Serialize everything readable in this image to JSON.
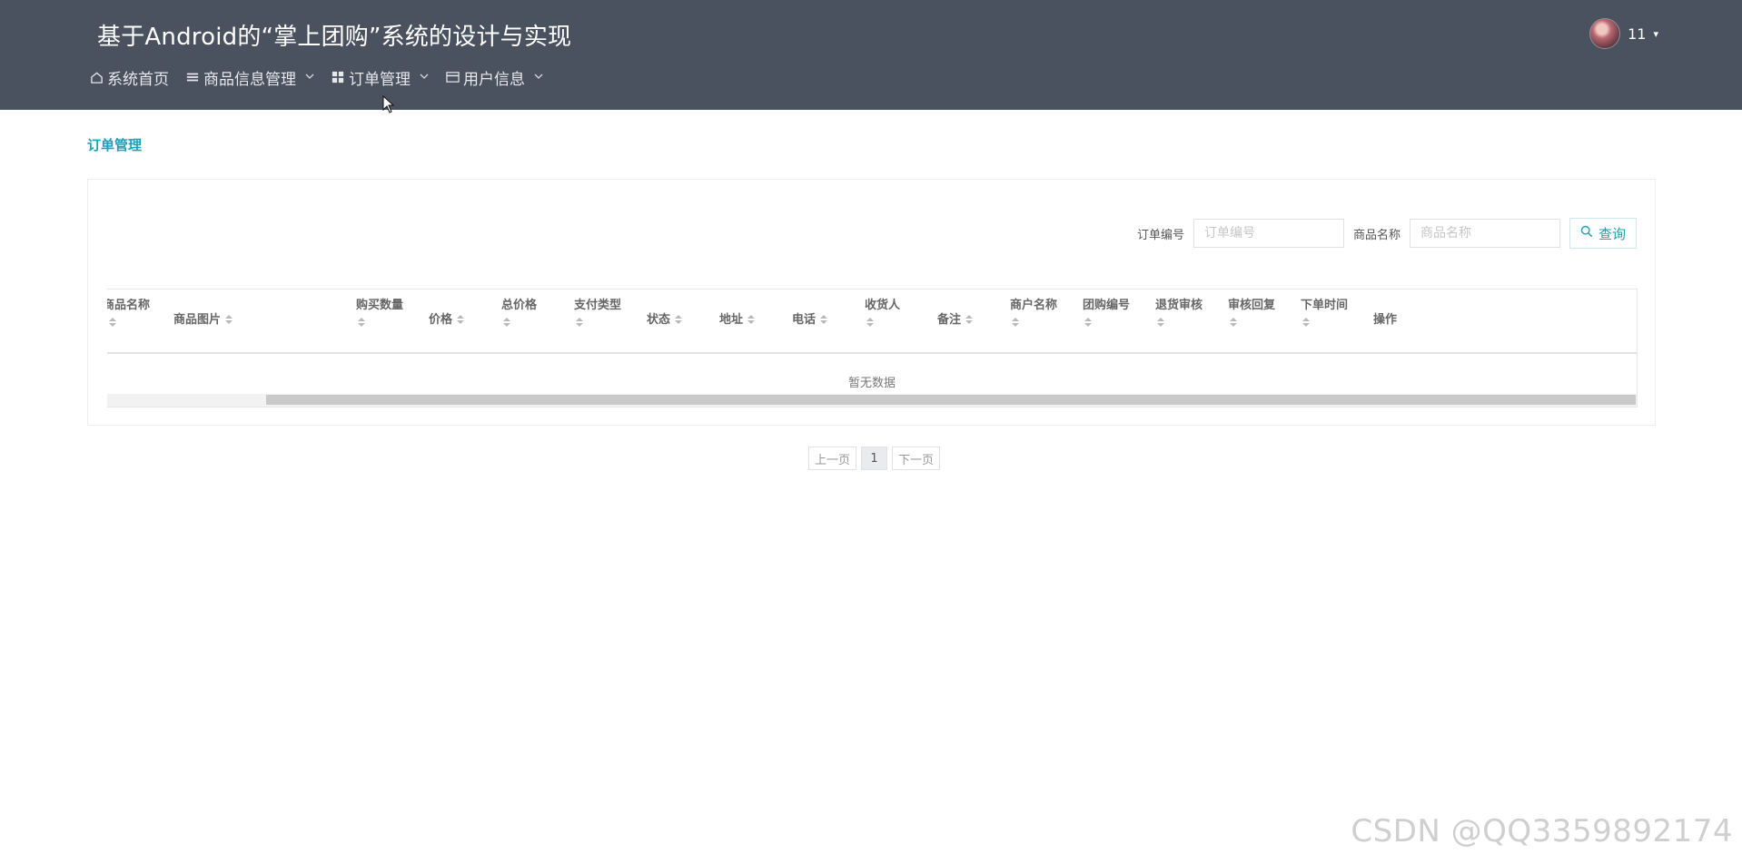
{
  "app": {
    "title": "基于Android的“掌上团购”系统的设计与实现"
  },
  "user": {
    "name": "11",
    "caret": "▾"
  },
  "nav": [
    {
      "label": "系统首页",
      "icon": "home-icon",
      "dropdown": false
    },
    {
      "label": "商品信息管理",
      "icon": "list-icon",
      "dropdown": true
    },
    {
      "label": "订单管理",
      "icon": "grid-icon",
      "dropdown": true
    },
    {
      "label": "用户信息",
      "icon": "card-icon",
      "dropdown": true
    }
  ],
  "breadcrumb": "订单管理",
  "search": {
    "order_no_label": "订单编号",
    "order_no_placeholder": "订单编号",
    "product_name_label": "商品名称",
    "product_name_placeholder": "商品名称",
    "button_label": "查询"
  },
  "table": {
    "columns": [
      "商品名称",
      "商品图片",
      "购买数量",
      "价格",
      "总价格",
      "支付类型",
      "状态",
      "地址",
      "电话",
      "收货人",
      "备注",
      "商户名称",
      "团购编号",
      "退货审核",
      "审核回复",
      "下单时间",
      "操作"
    ],
    "empty_text": "暂无数据"
  },
  "pagination": {
    "prev": "上一页",
    "current": "1",
    "next": "下一页"
  },
  "watermark": "CSDN @QQ3359892174",
  "colors": {
    "header_bg": "#4a515f",
    "accent": "#17a2b8"
  }
}
